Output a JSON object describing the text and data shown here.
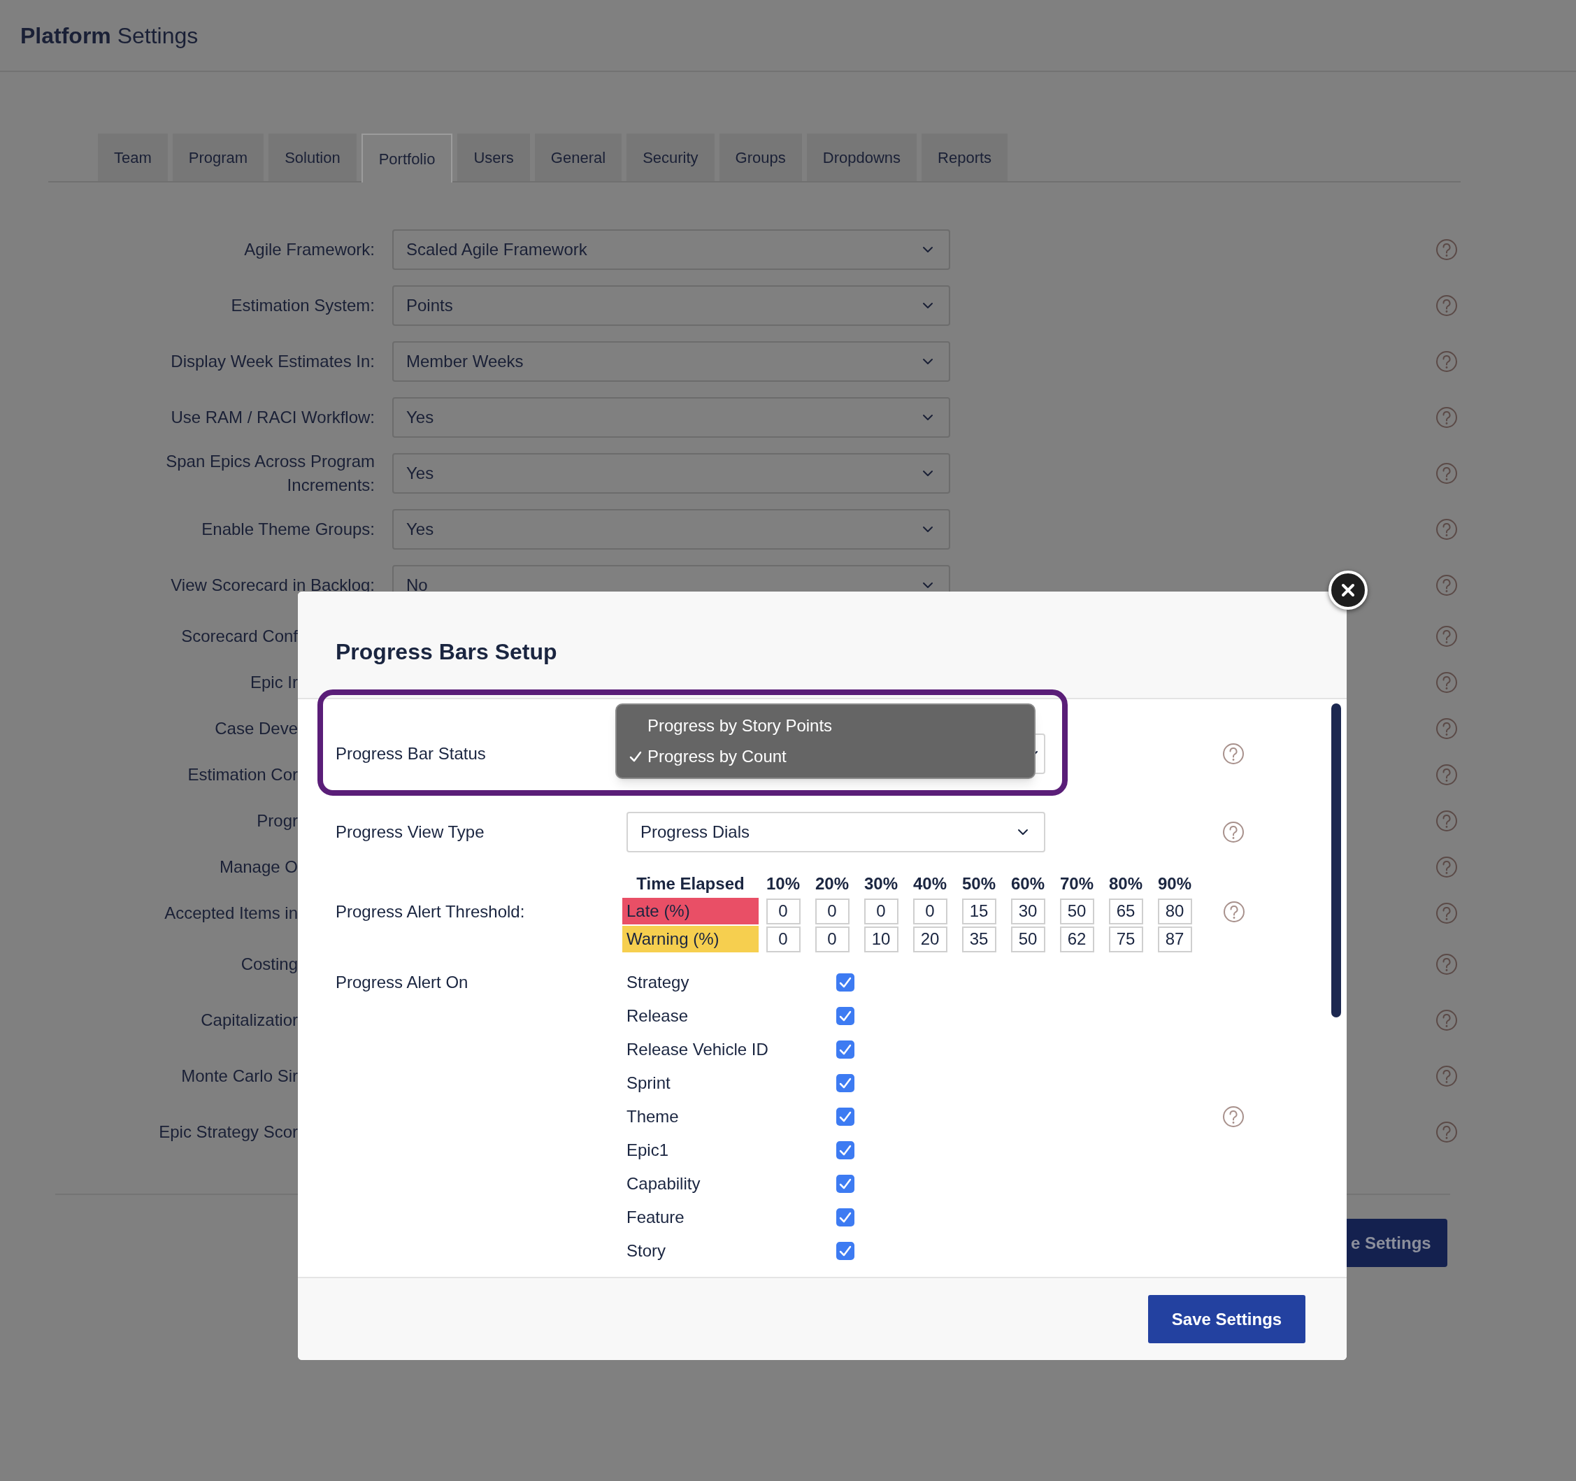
{
  "page_title": "**Platform** Settings",
  "tabs": [
    {
      "label": "Team",
      "selected": false
    },
    {
      "label": "Program",
      "selected": false
    },
    {
      "label": "Solution",
      "selected": false
    },
    {
      "label": "Portfolio",
      "selected": true
    },
    {
      "label": "Users",
      "selected": false
    },
    {
      "label": "General",
      "selected": false
    },
    {
      "label": "Security",
      "selected": false
    },
    {
      "label": "Groups",
      "selected": false
    },
    {
      "label": "Dropdowns",
      "selected": false
    },
    {
      "label": "Reports",
      "selected": false
    }
  ],
  "settings": [
    {
      "kind": "select",
      "label": "Agile Framework:",
      "value": "Scaled Agile Framework"
    },
    {
      "kind": "select",
      "label": "Estimation System:",
      "value": "Points"
    },
    {
      "kind": "select",
      "label": "Display Week Estimates In:",
      "value": "Member Weeks"
    },
    {
      "kind": "select",
      "label": "Use RAM / RACI Workflow:",
      "value": "Yes"
    },
    {
      "kind": "select",
      "label": "Span Epics Across Program Increments:",
      "value": "Yes"
    },
    {
      "kind": "select",
      "label": "Enable Theme Groups:",
      "value": "Yes"
    },
    {
      "kind": "select",
      "label": "View Scorecard in Backlog:",
      "value": "No"
    },
    {
      "kind": "label",
      "label": "Scorecard Conf"
    },
    {
      "kind": "label",
      "label": "Epic Ir"
    },
    {
      "kind": "label",
      "label": "Case Deve"
    },
    {
      "kind": "label",
      "label": "Estimation Cor"
    },
    {
      "kind": "label",
      "label": "Progr"
    },
    {
      "kind": "label",
      "label": "Manage O"
    },
    {
      "kind": "label",
      "label": "Accepted Items in"
    },
    {
      "kind": "label",
      "label": "Costing"
    },
    {
      "kind": "label",
      "label": "Capitalizatior"
    },
    {
      "kind": "label",
      "label": "Monte Carlo Sir"
    },
    {
      "kind": "label",
      "label": "Epic Strategy Scor"
    }
  ],
  "page_save_button": "e Settings",
  "dialog": {
    "title": "Progress Bars Setup",
    "progress_bar_status": {
      "label": "Progress Bar Status",
      "options": [
        {
          "label": "Progress by Story Points",
          "selected": false
        },
        {
          "label": "Progress by Count",
          "selected": true
        }
      ]
    },
    "progress_view_type": {
      "label": "Progress View Type",
      "value": "Progress Dials"
    },
    "alert_threshold": {
      "label": "Progress Alert Threshold:",
      "header": "Time Elapsed",
      "columns": [
        "10%",
        "20%",
        "30%",
        "40%",
        "50%",
        "60%",
        "70%",
        "80%",
        "90%"
      ],
      "rows": [
        {
          "label": "Late (%)",
          "color": "#e94f66",
          "values": [
            "0",
            "0",
            "0",
            "0",
            "15",
            "30",
            "50",
            "65",
            "80"
          ]
        },
        {
          "label": "Warning (%)",
          "color": "#f6cf4f",
          "values": [
            "0",
            "0",
            "10",
            "20",
            "35",
            "50",
            "62",
            "75",
            "87"
          ]
        }
      ]
    },
    "alert_on": {
      "label": "Progress Alert On",
      "items": [
        {
          "label": "Strategy",
          "checked": true
        },
        {
          "label": "Release",
          "checked": true
        },
        {
          "label": "Release Vehicle ID",
          "checked": true
        },
        {
          "label": "Sprint",
          "checked": true
        },
        {
          "label": "Theme",
          "checked": true
        },
        {
          "label": "Epic1",
          "checked": true
        },
        {
          "label": "Capability",
          "checked": true
        },
        {
          "label": "Feature",
          "checked": true
        },
        {
          "label": "Story",
          "checked": true
        }
      ]
    },
    "save_button": "Save Settings"
  }
}
